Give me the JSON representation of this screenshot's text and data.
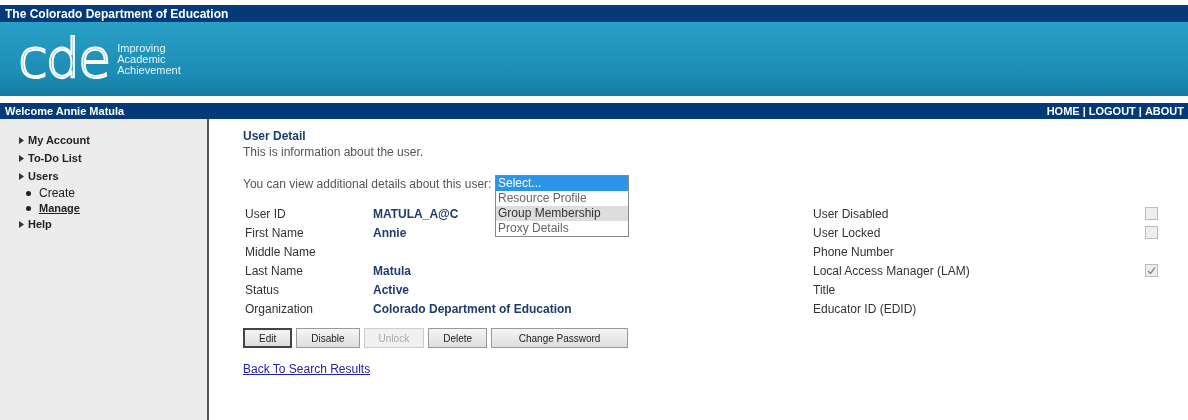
{
  "top_bar": {
    "title": "The Colorado Department of Education"
  },
  "banner": {
    "logo": "cde",
    "tagline": [
      "Improving",
      "Academic",
      "Achievement"
    ]
  },
  "nav_bar": {
    "welcome": "Welcome Annie Matula",
    "links": [
      "HOME",
      "LOGOUT",
      "ABOUT"
    ],
    "separator": "|"
  },
  "sidebar": {
    "items": [
      {
        "label": "My Account"
      },
      {
        "label": "To-Do List"
      },
      {
        "label": "Users",
        "children": [
          {
            "label": "Create",
            "selected": false
          },
          {
            "label": "Manage",
            "selected": true
          }
        ]
      },
      {
        "label": "Help"
      }
    ]
  },
  "content": {
    "heading": "User Detail",
    "intro": "This is information about the user.",
    "details_prompt": "You can view additional details about this user:",
    "details_dropdown": {
      "options": [
        {
          "label": "Select...",
          "selected": true,
          "highlighted": false
        },
        {
          "label": "Resource Profile",
          "selected": false,
          "highlighted": false
        },
        {
          "label": "Group Membership",
          "selected": false,
          "highlighted": true
        },
        {
          "label": "Proxy Details",
          "selected": false,
          "highlighted": false
        }
      ]
    },
    "left_fields": [
      {
        "label": "User ID",
        "value": "MATULA_A@C"
      },
      {
        "label": "First Name",
        "value": "Annie"
      },
      {
        "label": "Middle Name"
      },
      {
        "label": "Last Name",
        "value": "Matula"
      },
      {
        "label": "Status",
        "value": "Active"
      },
      {
        "label": "Organization",
        "value": "Colorado Department of Education"
      }
    ],
    "right_fields": [
      {
        "label": "User Disabled",
        "kind": "checkbox",
        "checked": false
      },
      {
        "label": "User Locked",
        "kind": "checkbox",
        "checked": false
      },
      {
        "label": "Phone Number",
        "kind": "text"
      },
      {
        "label": "Local Access Manager (LAM)",
        "kind": "checkbox",
        "checked": true
      },
      {
        "label": "Title",
        "kind": "text"
      },
      {
        "label": "Educator ID (EDID)",
        "kind": "text"
      }
    ],
    "buttons": [
      {
        "label": "Edit",
        "disabled": false,
        "focused": true
      },
      {
        "label": "Disable",
        "disabled": false,
        "focused": false
      },
      {
        "label": "Unlock",
        "disabled": true,
        "focused": false
      },
      {
        "label": "Delete",
        "disabled": false,
        "focused": false
      },
      {
        "label": "Change Password",
        "disabled": false,
        "focused": false
      }
    ],
    "back_link": "Back To Search Results"
  }
}
